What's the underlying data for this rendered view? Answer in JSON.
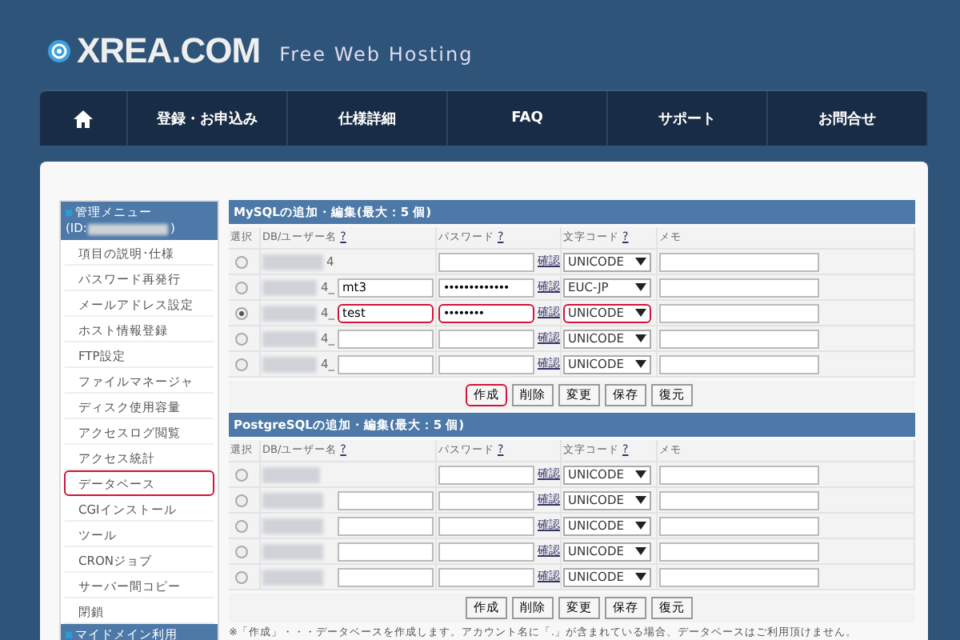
{
  "header": {
    "logo": "XREA.COM",
    "tagline": "Free Web Hosting"
  },
  "nav": [
    {
      "kind": "home"
    },
    {
      "kind": "text",
      "label": "登録・お申込み"
    },
    {
      "kind": "text",
      "label": "仕様詳細"
    },
    {
      "kind": "text",
      "label": "FAQ"
    },
    {
      "kind": "text",
      "label": "サポート"
    },
    {
      "kind": "text",
      "label": "お問合せ"
    }
  ],
  "sidebar": {
    "heading": "管理メニュー",
    "id_prefix": "(ID:",
    "id_suffix": ")",
    "items": [
      {
        "label": "項目の説明･仕様",
        "highlighted": false
      },
      {
        "label": "パスワード再発行",
        "highlighted": false
      },
      {
        "label": "メールアドレス設定",
        "highlighted": false
      },
      {
        "label": "ホスト情報登録",
        "highlighted": false
      },
      {
        "label": "FTP設定",
        "highlighted": false
      },
      {
        "label": "ファイルマネージャ",
        "highlighted": false
      },
      {
        "label": "ディスク使用容量",
        "highlighted": false
      },
      {
        "label": "アクセスログ閲覧",
        "highlighted": false
      },
      {
        "label": "アクセス統計",
        "highlighted": false
      },
      {
        "label": "データベース",
        "highlighted": true
      },
      {
        "label": "CGIインストール",
        "highlighted": false
      },
      {
        "label": "ツール",
        "highlighted": false
      },
      {
        "label": "CRONジョブ",
        "highlighted": false
      },
      {
        "label": "サーバー間コピー",
        "highlighted": false
      },
      {
        "label": "閉鎖",
        "highlighted": false
      }
    ],
    "footer_heading": "マイドメイン利用"
  },
  "sections": [
    {
      "title": "MySQLの追加・編集(最大：5 個)",
      "columns": [
        "選択",
        "DB/ユーザー名",
        "パスワード",
        "文字コード",
        "メモ"
      ],
      "help_mark": "?",
      "rows": [
        {
          "kind": "existing",
          "selected": false,
          "suffix": "4",
          "confirm": "確認",
          "password": "",
          "password_highlighted": false,
          "charset": "UNICODE",
          "charset_highlighted": false
        },
        {
          "kind": "new",
          "selected": false,
          "suffix": "4_",
          "confirm": "確認",
          "name": "mt3",
          "name_highlighted": false,
          "password": "•••••••••••••",
          "password_highlighted": false,
          "charset": "EUC-JP",
          "charset_highlighted": false
        },
        {
          "kind": "new",
          "selected": true,
          "suffix": "4_",
          "confirm": "確認",
          "name": "test",
          "name_highlighted": true,
          "password": "••••••••",
          "password_highlighted": true,
          "charset": "UNICODE",
          "charset_highlighted": true
        },
        {
          "kind": "new",
          "selected": false,
          "suffix": "4_",
          "confirm": "確認",
          "name": "",
          "name_highlighted": false,
          "password": "",
          "password_highlighted": false,
          "charset": "UNICODE",
          "charset_highlighted": false
        },
        {
          "kind": "new",
          "selected": false,
          "suffix": "4_",
          "confirm": "確認",
          "name": "",
          "name_highlighted": false,
          "password": "",
          "password_highlighted": false,
          "charset": "UNICODE",
          "charset_highlighted": false
        }
      ],
      "buttons": [
        {
          "label": "作成",
          "highlighted": true
        },
        {
          "label": "削除",
          "highlighted": false
        },
        {
          "label": "変更",
          "highlighted": false
        },
        {
          "label": "保存",
          "highlighted": false
        },
        {
          "label": "復元",
          "highlighted": false
        }
      ]
    },
    {
      "title": "PostgreSQLの追加・編集(最大：5 個)",
      "columns": [
        "選択",
        "DB/ユーザー名",
        "パスワード",
        "文字コード",
        "メモ"
      ],
      "help_mark": "?",
      "rows": [
        {
          "kind": "existing",
          "selected": false,
          "suffix": "",
          "confirm": "確認",
          "password": "",
          "password_highlighted": false,
          "charset": "UNICODE",
          "charset_highlighted": false
        },
        {
          "kind": "new",
          "selected": false,
          "suffix": "",
          "confirm": "確認",
          "name": "",
          "name_highlighted": false,
          "password": "",
          "password_highlighted": false,
          "charset": "UNICODE",
          "charset_highlighted": false
        },
        {
          "kind": "new",
          "selected": false,
          "suffix": "",
          "confirm": "確認",
          "name": "",
          "name_highlighted": false,
          "password": "",
          "password_highlighted": false,
          "charset": "UNICODE",
          "charset_highlighted": false
        },
        {
          "kind": "new",
          "selected": false,
          "suffix": "",
          "confirm": "確認",
          "name": "",
          "name_highlighted": false,
          "password": "",
          "password_highlighted": false,
          "charset": "UNICODE",
          "charset_highlighted": false
        },
        {
          "kind": "new",
          "selected": false,
          "suffix": "",
          "confirm": "確認",
          "name": "",
          "name_highlighted": false,
          "password": "",
          "password_highlighted": false,
          "charset": "UNICODE",
          "charset_highlighted": false
        }
      ],
      "buttons": [
        {
          "label": "作成",
          "highlighted": false
        },
        {
          "label": "削除",
          "highlighted": false
        },
        {
          "label": "変更",
          "highlighted": false
        },
        {
          "label": "保存",
          "highlighted": false
        },
        {
          "label": "復元",
          "highlighted": false
        }
      ]
    }
  ],
  "footnote": "※「作成」・・・データベースを作成します。アカウント名に「.」が含まれている場合、データベースはご利用頂けません。"
}
